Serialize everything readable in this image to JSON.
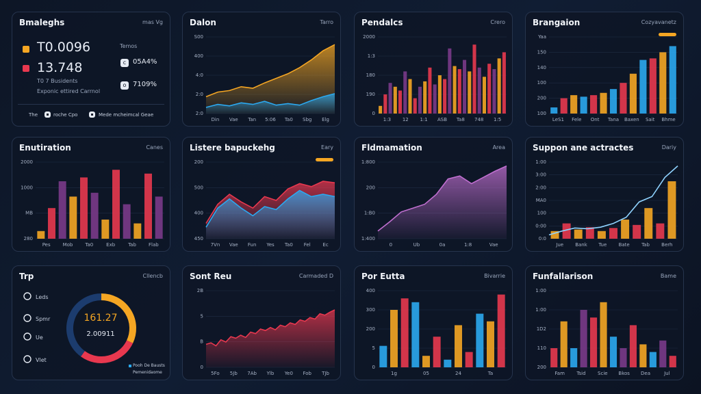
{
  "colors": {
    "orange": "#f5a623",
    "red": "#e8384f",
    "blue": "#2ba9f0",
    "purple": "#7a3a8a",
    "deep": "#1c3c6e"
  },
  "p1": {
    "title": "Bmaleghs",
    "label": "mas Vg",
    "stat1_value": "T0.0096",
    "stat1_color": "#f5a623",
    "stat2_value": "13.748",
    "stat2_color": "#e8384f",
    "right_label": "Temos",
    "kpi1": "05A4%",
    "kpi2": "7109%",
    "line1": "T0 7 Busidents",
    "line2": "Exponic ettired Carrnol",
    "footer_a": "The",
    "footer_b": "roche Cpo",
    "footer_c": "Mede mcheimcal Geae"
  },
  "chart_data": [
    {
      "id": "c2",
      "type": "area",
      "title": "Dalon",
      "label": "Tarro",
      "x": [
        "Din",
        "Vae",
        "Tan",
        "5:06",
        "Ta0",
        "Sbg",
        "Elg"
      ],
      "yticks": [
        "S00",
        "400",
        "4:0",
        "2:0",
        "2:0"
      ],
      "ylim": [
        0,
        100
      ],
      "series": [
        {
          "values": [
            22,
            28,
            30,
            35,
            33,
            40,
            46,
            52,
            60,
            70,
            82,
            90
          ],
          "color": "#f5a623"
        },
        {
          "values": [
            8,
            12,
            10,
            14,
            12,
            16,
            11,
            13,
            11,
            17,
            22,
            26
          ],
          "color": "#2ba9f0"
        }
      ]
    },
    {
      "id": "c3",
      "type": "bar",
      "title": "Pendalcs",
      "label": "Crero",
      "x": [
        "1:3",
        "12",
        "1:1",
        "ASB",
        "Ta8",
        "748",
        "1:5"
      ],
      "yticks": [
        "2000",
        "1:3",
        "180",
        "190",
        "0"
      ],
      "ylim": [
        0,
        100
      ],
      "values": [
        10,
        25,
        40,
        35,
        30,
        55,
        45,
        20,
        35,
        42,
        60,
        38,
        50,
        45,
        85,
        62,
        58,
        70,
        55,
        90,
        60,
        48,
        65,
        58,
        72,
        80
      ],
      "colors": [
        "#f5a623",
        "#e8384f",
        "#7a3a8a"
      ]
    },
    {
      "id": "c4",
      "type": "bar",
      "title": "Brangaion",
      "label": "Cozyavanetz",
      "x": [
        "LeS1",
        "Fele",
        "Ont",
        "Tana",
        "Baxen",
        "Sait",
        "Bhme"
      ],
      "yticks": [
        "Yaa",
        "150",
        "140",
        "100",
        "200",
        "100"
      ],
      "ylim": [
        0,
        100
      ],
      "values": [
        8,
        20,
        24,
        22,
        24,
        27,
        32,
        40,
        52,
        70,
        72,
        80,
        88
      ],
      "colors": [
        "#2ba9f0",
        "#e8384f",
        "#f5a623"
      ]
    },
    {
      "id": "c5",
      "type": "bar",
      "title": "Enutiration",
      "label": "Canes",
      "x": [
        "Pes",
        "Mob",
        "Ta0",
        "Exb",
        "Tab",
        "Flab"
      ],
      "yticks": [
        "2000",
        "1000",
        "MB",
        "280"
      ],
      "ylim": [
        0,
        100
      ],
      "values": [
        10,
        40,
        75,
        55,
        80,
        60,
        25,
        90,
        45,
        20,
        85,
        55
      ],
      "colors": [
        "#f5a623",
        "#e8384f",
        "#7a3a8a"
      ]
    },
    {
      "id": "c6",
      "type": "line",
      "title": "Listere bapuckehg",
      "label": "Eary",
      "x": [
        "7Vn",
        "Vae",
        "Fun",
        "Yes",
        "Ta0",
        "Fel",
        "Ec"
      ],
      "yticks": [
        "200",
        "500",
        "400",
        "450"
      ],
      "ylim": [
        0,
        100
      ],
      "series": [
        {
          "values": [
            20,
            45,
            58,
            48,
            40,
            55,
            50,
            65,
            72,
            68,
            75,
            73
          ],
          "color": "#e8384f"
        },
        {
          "values": [
            15,
            40,
            52,
            40,
            30,
            42,
            38,
            52,
            63,
            55,
            58,
            55
          ],
          "color": "#2ba9f0"
        }
      ]
    },
    {
      "id": "c7",
      "type": "line",
      "title": "Fldmamation",
      "label": "Area",
      "x": [
        "0",
        "Ub",
        "0a",
        "1:8",
        "Vae"
      ],
      "yticks": [
        "1:800",
        "200",
        "1:B0",
        "1:400"
      ],
      "ylim": [
        0,
        100
      ],
      "series": [
        {
          "values": [
            10,
            22,
            35,
            40,
            45,
            58,
            78,
            82,
            72,
            80,
            88,
            95
          ],
          "color": "#c06fd0"
        }
      ]
    },
    {
      "id": "c8",
      "type": "bar",
      "title": "Suppon ane actractes",
      "label": "Dariy",
      "x": [
        "Jue",
        "Bank",
        "Tue",
        "Bate",
        "Tab",
        "Berh"
      ],
      "yticks": [
        "1:00",
        "3:00",
        "2:00",
        "MA0",
        "100",
        "0:00",
        "0:0"
      ],
      "ylim": [
        0,
        100
      ],
      "values": [
        10,
        20,
        12,
        15,
        10,
        14,
        25,
        18,
        40,
        20,
        75
      ],
      "colors": [
        "#f5a623",
        "#e8384f"
      ],
      "line": [
        5,
        10,
        14,
        13,
        15,
        20,
        28,
        48,
        55,
        80,
        95
      ]
    },
    {
      "id": "c9",
      "type": "pie",
      "title": "Trp",
      "label": "Cllencb",
      "center_value": "161.27",
      "center_sub": "2.00911",
      "legend": [
        "Leds",
        "Spmr",
        "Ue",
        "Vlet"
      ],
      "slices": [
        {
          "value": 32,
          "color": "#f5a623"
        },
        {
          "value": 28,
          "color": "#e8384f"
        },
        {
          "value": 40,
          "color": "#1c3c6e"
        }
      ],
      "foot1": "Pooh De Bausts",
      "foot2": "Pemenidaome"
    },
    {
      "id": "c10",
      "type": "area",
      "title": "Sont Reu",
      "label": "Carmaded D",
      "x": [
        "5Fo",
        "5Jb",
        "7Ab",
        "Ylb",
        "Ye0",
        "Fob",
        "TJb"
      ],
      "yticks": [
        "2B",
        "5",
        "B",
        "0"
      ],
      "ylim": [
        0,
        100
      ],
      "values": [
        30,
        32,
        28,
        36,
        33,
        40,
        38,
        42,
        39,
        46,
        44,
        50,
        48,
        52,
        49,
        55,
        53,
        58,
        56,
        62,
        60,
        65,
        63,
        70,
        68,
        72,
        75
      ],
      "color": "#e8384f"
    },
    {
      "id": "c11",
      "type": "bar",
      "title": "Por Eutta",
      "label": "Bivarrie",
      "x": [
        "1g",
        "05",
        "24",
        "Ta"
      ],
      "yticks": [
        "400",
        "300",
        "200",
        "5",
        "0"
      ],
      "ylim": [
        0,
        100
      ],
      "values": [
        28,
        75,
        90,
        85,
        15,
        40,
        10,
        55,
        20,
        70,
        60,
        95
      ],
      "colors": [
        "#2ba9f0",
        "#f5a623",
        "#e8384f"
      ]
    },
    {
      "id": "c12",
      "type": "bar",
      "title": "Funfallarison",
      "label": "Bame",
      "x": [
        "Fam",
        "Tsid",
        "Scie",
        "Bkos",
        "Dea",
        "Jul"
      ],
      "yticks": [
        "1:00",
        "1:00",
        "1D2",
        "110",
        "200"
      ],
      "ylim": [
        0,
        100
      ],
      "values": [
        25,
        60,
        25,
        75,
        65,
        85,
        40,
        25,
        55,
        30,
        20,
        35,
        15
      ],
      "colors": [
        "#e8384f",
        "#f5a623",
        "#2ba9f0",
        "#7a3a8a"
      ]
    }
  ]
}
